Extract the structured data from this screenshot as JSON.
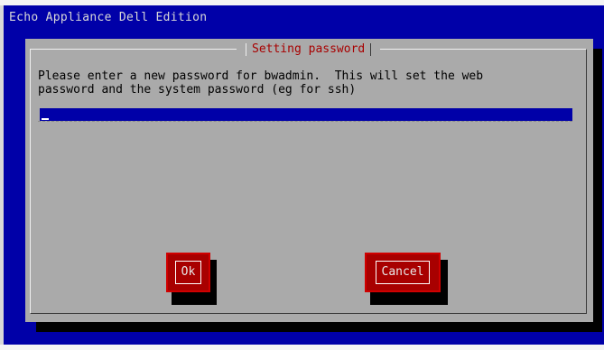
{
  "screen": {
    "backtitle": "Echo Appliance Dell Edition"
  },
  "dialog": {
    "title": "Setting password",
    "prompt": "Please enter a new password for bwadmin.  This will set the web\npassword and the system password (eg for ssh)",
    "password_value": ""
  },
  "buttons": {
    "ok": "Ok",
    "cancel": "Cancel"
  },
  "colors": {
    "background": "#0000a8",
    "dialog": "#aaaaaa",
    "title": "#a80000",
    "button": "#a80000"
  }
}
